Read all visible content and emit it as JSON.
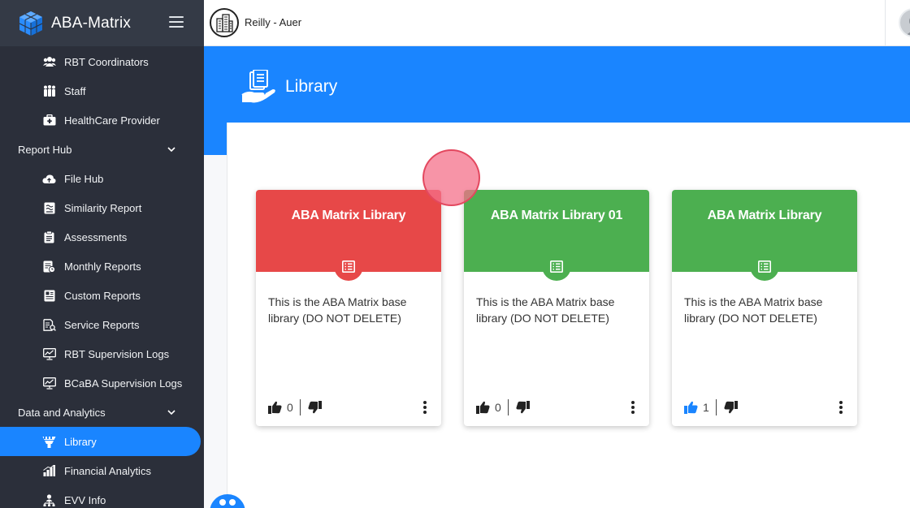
{
  "app": {
    "name": "ABA-Matrix",
    "organization": "Reilly - Auer"
  },
  "sidebar": {
    "items": [
      {
        "label": "RBT Coordinators",
        "icon": "users-icon",
        "type": "item"
      },
      {
        "label": "Staff",
        "icon": "staff-icon",
        "type": "item"
      },
      {
        "label": "HealthCare Provider",
        "icon": "medical-kit-icon",
        "type": "item"
      },
      {
        "label": "Report Hub",
        "icon": "chevron-down-icon",
        "type": "section"
      },
      {
        "label": "File Hub",
        "icon": "cloud-icon",
        "type": "item"
      },
      {
        "label": "Similarity Report",
        "icon": "wave-report-icon",
        "type": "item"
      },
      {
        "label": "Assessments",
        "icon": "clipboard-icon",
        "type": "item"
      },
      {
        "label": "Monthly Reports",
        "icon": "calendar-report-icon",
        "type": "item"
      },
      {
        "label": "Custom Reports",
        "icon": "document-icon",
        "type": "item"
      },
      {
        "label": "Service Reports",
        "icon": "search-document-icon",
        "type": "item"
      },
      {
        "label": "RBT Supervision Logs",
        "icon": "monitor-chart-icon",
        "type": "item"
      },
      {
        "label": "BCaBA Supervision Logs",
        "icon": "monitor-chart-icon",
        "type": "item"
      },
      {
        "label": "Data and Analytics",
        "icon": "chevron-down-icon",
        "type": "section"
      },
      {
        "label": "Library",
        "icon": "library-icon",
        "type": "item",
        "active": true
      },
      {
        "label": "Financial Analytics",
        "icon": "bar-chart-icon",
        "type": "item"
      },
      {
        "label": "EVV Info",
        "icon": "network-icon",
        "type": "item"
      }
    ]
  },
  "page": {
    "title": "Library"
  },
  "cards": [
    {
      "title": "ABA Matrix Library",
      "color": "#e74848",
      "description": "This is the ABA Matrix base library (DO NOT DELETE)",
      "likes": "0",
      "liked": false
    },
    {
      "title": "ABA Matrix Library 01",
      "color": "#4caf50",
      "description": "This is the ABA Matrix base library (DO NOT DELETE)",
      "likes": "0",
      "liked": false
    },
    {
      "title": "ABA Matrix Library",
      "color": "#4caf50",
      "description": "This is the ABA Matrix base library (DO NOT DELETE)",
      "likes": "1",
      "liked": true
    }
  ],
  "colors": {
    "accent": "#1a85ff",
    "sidebar": "#2b2f3a",
    "liked": "#1a85ff"
  }
}
